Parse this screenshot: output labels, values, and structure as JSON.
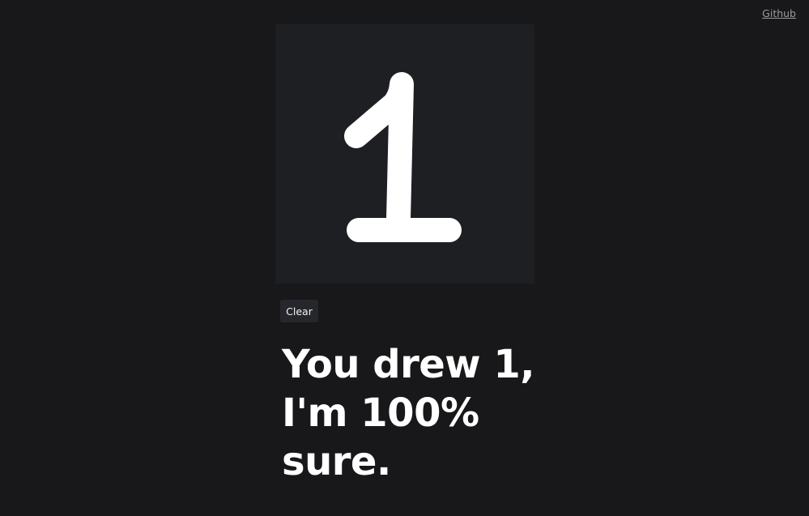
{
  "header": {
    "github_label": "Github"
  },
  "canvas": {
    "background_color": "#1e1f23",
    "stroke_color": "#ffffff",
    "drawn_content": "handwritten digit 1"
  },
  "controls": {
    "clear_label": "Clear"
  },
  "result": {
    "line1": "You drew 1,",
    "line2": "I'm 100%",
    "line3": "sure."
  },
  "colors": {
    "page_background": "#18181a",
    "text": "#ffffff",
    "link": "#9a9aa0",
    "button_background": "#26272c"
  }
}
